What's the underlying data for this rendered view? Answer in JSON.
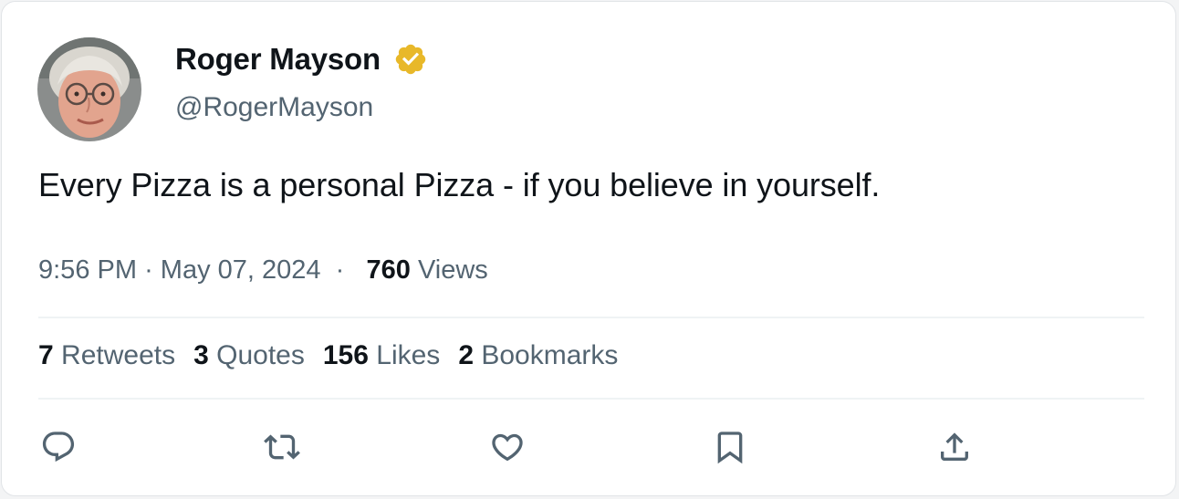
{
  "author": {
    "name": "Roger Mayson",
    "handle": "@RogerMayson",
    "verified_icon": "verified-badge-icon",
    "badge_color": "#e8b829"
  },
  "tweet": {
    "text": "Every Pizza is a personal Pizza - if you believe in yourself.",
    "time": "9:56 PM",
    "date": "May 07, 2024",
    "separator": "·",
    "views_count": "760",
    "views_label": "Views"
  },
  "stats": [
    {
      "count": "7",
      "label": "Retweets"
    },
    {
      "count": "3",
      "label": "Quotes"
    },
    {
      "count": "156",
      "label": "Likes"
    },
    {
      "count": "2",
      "label": "Bookmarks"
    }
  ],
  "actions": [
    {
      "name": "reply",
      "icon": "reply-icon"
    },
    {
      "name": "retweet",
      "icon": "retweet-icon"
    },
    {
      "name": "like",
      "icon": "heart-icon"
    },
    {
      "name": "bookmark",
      "icon": "bookmark-icon"
    },
    {
      "name": "share",
      "icon": "share-icon"
    }
  ],
  "colors": {
    "primary_text": "#0f1419",
    "secondary_text": "#536471",
    "divider": "#eff3f4"
  }
}
